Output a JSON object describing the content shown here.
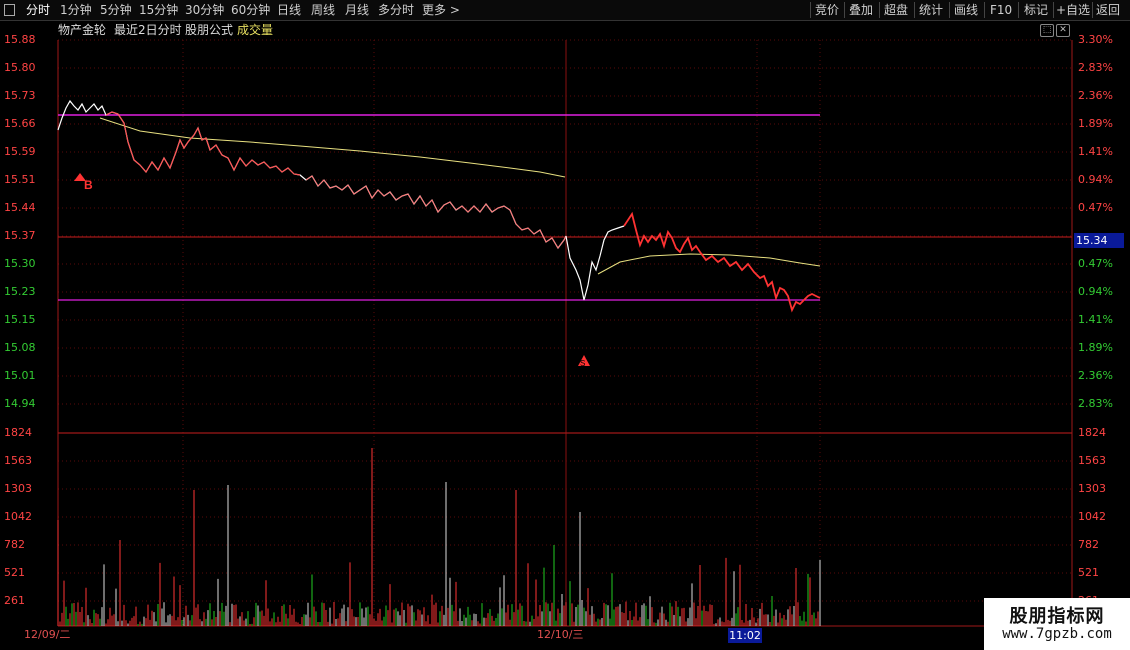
{
  "toolbar": {
    "periods": [
      "分时",
      "1分钟",
      "5分钟",
      "15分钟",
      "30分钟",
      "60分钟",
      "日线",
      "周线",
      "月线",
      "多分时",
      "更多 >"
    ],
    "active": "分时",
    "right_buttons": [
      "竞价",
      "叠加",
      "超盘",
      "统计",
      "画线",
      "F10",
      "标记",
      "+自选",
      "返回"
    ]
  },
  "info": {
    "stock_name": "物产金轮",
    "range_label": "最近2日分时",
    "formula": "股朋公式",
    "volume_label": "成交量"
  },
  "window_buttons": [
    "⬚",
    "✕"
  ],
  "price_axis": {
    "left": [
      "15.88",
      "15.80",
      "15.73",
      "15.66",
      "15.59",
      "15.51",
      "15.44",
      "15.37",
      "15.30",
      "15.23",
      "15.15",
      "15.08",
      "15.01",
      "14.94"
    ],
    "right": [
      "3.30%",
      "2.83%",
      "2.36%",
      "1.89%",
      "1.41%",
      "0.94%",
      "0.47%",
      "",
      "0.47%",
      "0.94%",
      "1.41%",
      "1.89%",
      "2.36%",
      "2.83%"
    ]
  },
  "volume_axis": {
    "left": [
      "1824",
      "1563",
      "1303",
      "1042",
      "782",
      "521",
      "261"
    ],
    "right": [
      "1824",
      "1563",
      "1303",
      "1042",
      "782",
      "521",
      "261"
    ]
  },
  "current_price": "15.34",
  "markers": [
    "B",
    "S"
  ],
  "dates": [
    "12/09/二",
    "12/10/三"
  ],
  "time_readout": "11:02",
  "watermark": {
    "title": "股朋指标网",
    "url": "www.7gpzb.com"
  },
  "colors": {
    "up": "#ff3333",
    "down": "#22cc22",
    "grid": "#7a1010",
    "magenta": "#e020e0",
    "avg": "#e8e080",
    "price": "#ffffff"
  }
}
